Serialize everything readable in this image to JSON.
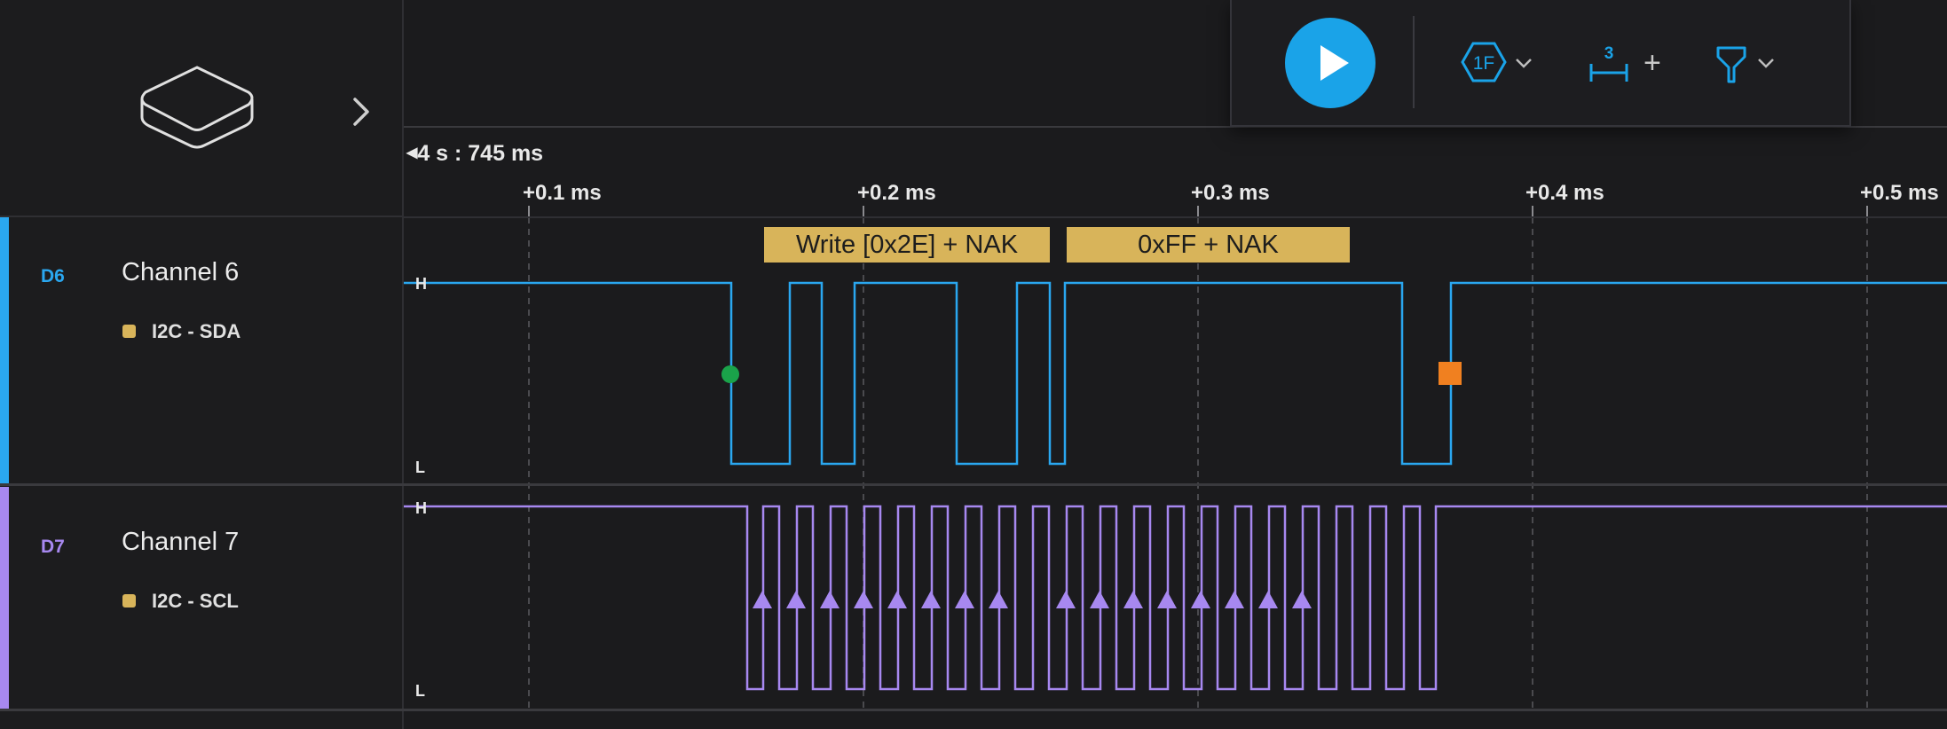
{
  "device": {
    "icon": "device-box-icon",
    "expand_icon": "chevron-right-icon"
  },
  "toolbar": {
    "play_icon": "play-icon",
    "analyzer_badge": "1F",
    "analyzer_icon": "hexagon-analyzer-icon",
    "measure_badge": "3",
    "measure_plus": "+",
    "measure_icon": "timing-marker-icon",
    "trigger_icon": "funnel-trigger-icon",
    "dropdown_icon": "chevron-down-icon"
  },
  "timeline": {
    "origin": "4 s : 745 ms",
    "ticks": [
      "+0.1 ms",
      "+0.2 ms",
      "+0.3 ms",
      "+0.4 ms",
      "+0.5 ms"
    ]
  },
  "channels": [
    {
      "id": "D6",
      "name": "Channel 6",
      "analyzer": "I2C - SDA",
      "color": "#2aa7f0",
      "high_label": "H",
      "low_label": "L",
      "protocol_frames": [
        "Write [0x2E] + NAK",
        "0xFF + NAK"
      ],
      "markers": [
        "start-marker",
        "stop-marker"
      ]
    },
    {
      "id": "D7",
      "name": "Channel 7",
      "analyzer": "I2C - SCL",
      "color": "#a788f0",
      "high_label": "H",
      "low_label": "L"
    }
  ],
  "colors": {
    "analyzer": "#d8b45a",
    "start": "#1aa34a",
    "stop": "#f08020",
    "accent": "#1aa3e8"
  }
}
